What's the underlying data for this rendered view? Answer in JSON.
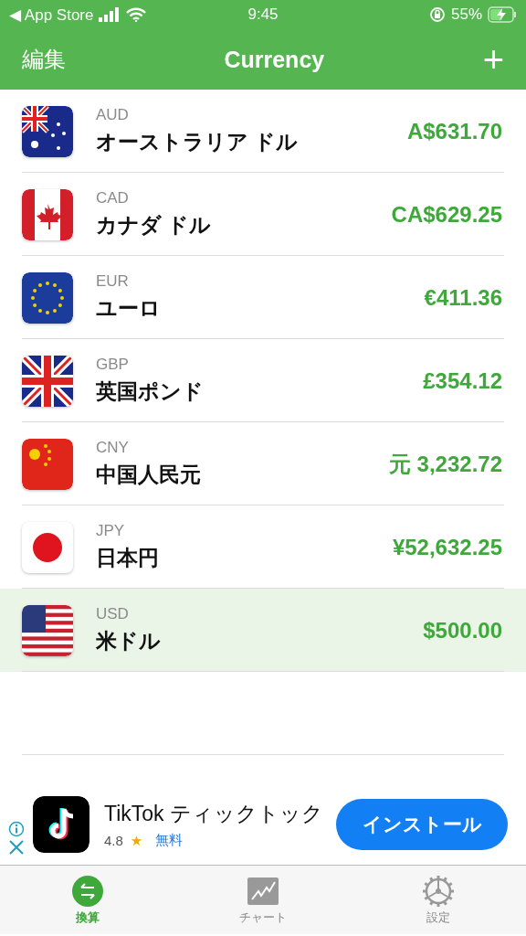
{
  "status_bar": {
    "back_label": "◀ App Store",
    "time": "9:45",
    "battery_text": "55%"
  },
  "nav": {
    "edit": "編集",
    "title": "Currency",
    "add": "+"
  },
  "currencies": [
    {
      "code": "AUD",
      "name": "オーストラリア ドル",
      "amount": "A$631.70",
      "kind": "au",
      "selected": false
    },
    {
      "code": "CAD",
      "name": "カナダ ドル",
      "amount": "CA$629.25",
      "kind": "ca",
      "selected": false
    },
    {
      "code": "EUR",
      "name": "ユーロ",
      "amount": "€411.36",
      "kind": "eu",
      "selected": false
    },
    {
      "code": "GBP",
      "name": "英国ポンド",
      "amount": "£354.12",
      "kind": "gb",
      "selected": false
    },
    {
      "code": "CNY",
      "name": "中国人民元",
      "amount": "元 3,232.72",
      "kind": "cn",
      "selected": false
    },
    {
      "code": "JPY",
      "name": "日本円",
      "amount": "¥52,632.25",
      "kind": "jp",
      "selected": false
    },
    {
      "code": "USD",
      "name": "米ドル",
      "amount": "$500.00",
      "kind": "us",
      "selected": true
    }
  ],
  "ad": {
    "app_name": "TikTok ティックトック",
    "rating": "4.8",
    "star": "★",
    "price": "無料",
    "install": "インストール"
  },
  "tabs": [
    {
      "label": "換算",
      "kind": "convert",
      "selected": true
    },
    {
      "label": "チャート",
      "kind": "chart",
      "selected": false
    },
    {
      "label": "設定",
      "kind": "settings",
      "selected": false
    }
  ]
}
